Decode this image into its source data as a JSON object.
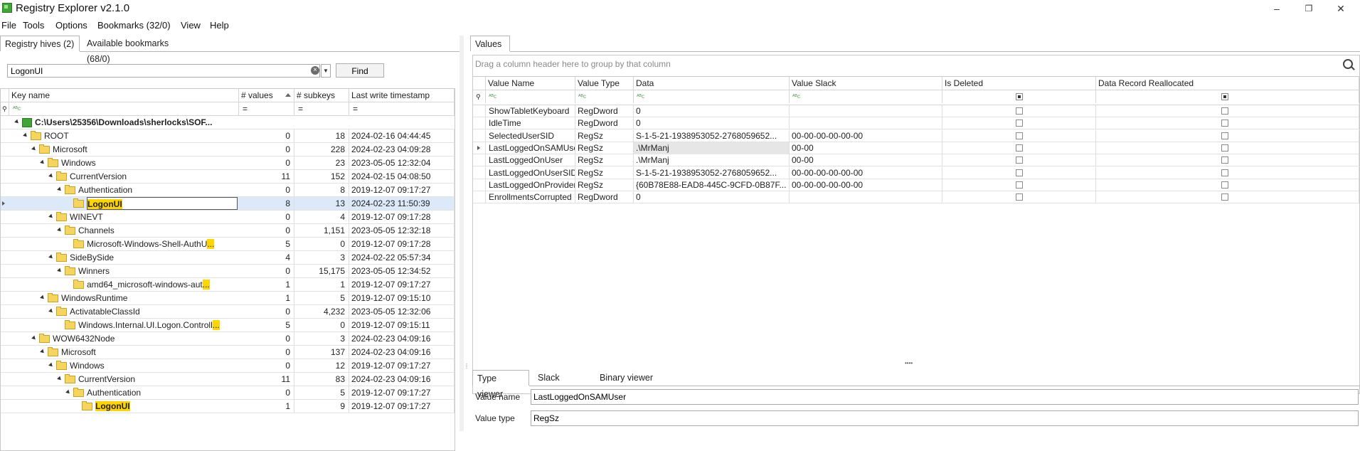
{
  "window": {
    "title": "Registry Explorer v2.1.0",
    "minimize": "–",
    "restore": "❐",
    "close": "✕"
  },
  "menu": [
    "File",
    "Tools",
    "Options",
    "Bookmarks (32/0)",
    "View",
    "Help"
  ],
  "left_tabs": [
    "Registry hives (2)",
    "Available bookmarks (68/0)"
  ],
  "search": {
    "value": "LogonUI",
    "clear": "×",
    "find_label": "Find"
  },
  "tree": {
    "columns": [
      "Key name",
      "# values",
      "# subkeys",
      "Last write timestamp"
    ],
    "filter_tokens": [
      "ᴬᴮc",
      "=",
      "=",
      "="
    ],
    "root": "C:\\Users\\25356\\Downloads\\sherlocks\\SOF...",
    "rows": [
      {
        "name": "ROOT",
        "values": "0",
        "subkeys": "18",
        "ts": "2024-02-16 04:44:45"
      },
      {
        "name": "Microsoft",
        "values": "0",
        "subkeys": "228",
        "ts": "2024-02-23 04:09:28"
      },
      {
        "name": "Windows",
        "values": "0",
        "subkeys": "23",
        "ts": "2023-05-05 12:32:04"
      },
      {
        "name": "CurrentVersion",
        "values": "11",
        "subkeys": "152",
        "ts": "2024-02-15 04:08:50"
      },
      {
        "name": "Authentication",
        "values": "0",
        "subkeys": "8",
        "ts": "2019-12-07 09:17:27"
      },
      {
        "name": "LogonUI",
        "values": "8",
        "subkeys": "13",
        "ts": "2024-02-23 11:50:39"
      },
      {
        "name": "WINEVT",
        "values": "0",
        "subkeys": "4",
        "ts": "2019-12-07 09:17:28"
      },
      {
        "name": "Channels",
        "values": "0",
        "subkeys": "1,151",
        "ts": "2023-05-05 12:32:18"
      },
      {
        "name": "Microsoft-Windows-Shell-AuthU",
        "name_hl": "...",
        "values": "5",
        "subkeys": "0",
        "ts": "2019-12-07 09:17:28"
      },
      {
        "name": "SideBySide",
        "values": "4",
        "subkeys": "3",
        "ts": "2024-02-22 05:57:34"
      },
      {
        "name": "Winners",
        "values": "0",
        "subkeys": "15,175",
        "ts": "2023-05-05 12:34:52"
      },
      {
        "name": "amd64_microsoft-windows-aut",
        "name_hl": "...",
        "values": "1",
        "subkeys": "1",
        "ts": "2019-12-07 09:17:27"
      },
      {
        "name": "WindowsRuntime",
        "values": "1",
        "subkeys": "5",
        "ts": "2019-12-07 09:15:10"
      },
      {
        "name": "ActivatableClassId",
        "values": "0",
        "subkeys": "4,232",
        "ts": "2023-05-05 12:32:06"
      },
      {
        "name": "Windows.Internal.UI.Logon.Controll",
        "name_hl": "...",
        "values": "5",
        "subkeys": "0",
        "ts": "2019-12-07 09:15:11"
      },
      {
        "name": "WOW6432Node",
        "values": "0",
        "subkeys": "3",
        "ts": "2024-02-23 04:09:16"
      },
      {
        "name": "Microsoft",
        "values": "0",
        "subkeys": "137",
        "ts": "2024-02-23 04:09:16"
      },
      {
        "name": "Windows",
        "values": "0",
        "subkeys": "12",
        "ts": "2019-12-07 09:17:27"
      },
      {
        "name": "CurrentVersion",
        "values": "11",
        "subkeys": "83",
        "ts": "2024-02-23 04:09:16"
      },
      {
        "name": "Authentication",
        "values": "0",
        "subkeys": "5",
        "ts": "2019-12-07 09:17:27"
      },
      {
        "name": "LogonUI",
        "values": "1",
        "subkeys": "9",
        "ts": "2019-12-07 09:17:27"
      }
    ]
  },
  "values_tab": "Values",
  "group_hint": "Drag a column header here to group by that column",
  "values": {
    "columns": [
      "Value Name",
      "Value Type",
      "Data",
      "Value Slack",
      "Is Deleted",
      "Data Record Reallocated"
    ],
    "filter_tokens": [
      "ᴬᴮc",
      "ᴬᴮc",
      "ᴬᴮc",
      "ᴬᴮc"
    ],
    "rows": [
      {
        "name": "ShowTabletKeyboard",
        "type": "RegDword",
        "data": "0",
        "slack": ""
      },
      {
        "name": "IdleTime",
        "type": "RegDword",
        "data": "0",
        "slack": ""
      },
      {
        "name": "SelectedUserSID",
        "type": "RegSz",
        "data": "S-1-5-21-1938953052-2768059652...",
        "slack": "00-00-00-00-00-00"
      },
      {
        "name": "LastLoggedOnSAMUser",
        "type": "RegSz",
        "data": ".\\MrManj",
        "slack": "00-00"
      },
      {
        "name": "LastLoggedOnUser",
        "type": "RegSz",
        "data": ".\\MrManj",
        "slack": "00-00"
      },
      {
        "name": "LastLoggedOnUserSID",
        "type": "RegSz",
        "data": "S-1-5-21-1938953052-2768059652...",
        "slack": "00-00-00-00-00-00"
      },
      {
        "name": "LastLoggedOnProvider",
        "type": "RegSz",
        "data": "{60B78E88-EAD8-445C-9CFD-0B87F...",
        "slack": "00-00-00-00-00-00"
      },
      {
        "name": "EnrollmentsCorrupted",
        "type": "RegDword",
        "data": "0",
        "slack": ""
      }
    ]
  },
  "bottom_tabs": [
    "Type viewer",
    "Slack viewer",
    "Binary viewer"
  ],
  "type_viewer": {
    "name_label": "Value name",
    "name_value": "LastLoggedOnSAMUser",
    "type_label": "Value type",
    "type_value": "RegSz"
  },
  "colors": {
    "highlight": "#ffd500",
    "selected_row": "#dbe9f9",
    "selected_cell": "#e6e6e6"
  }
}
